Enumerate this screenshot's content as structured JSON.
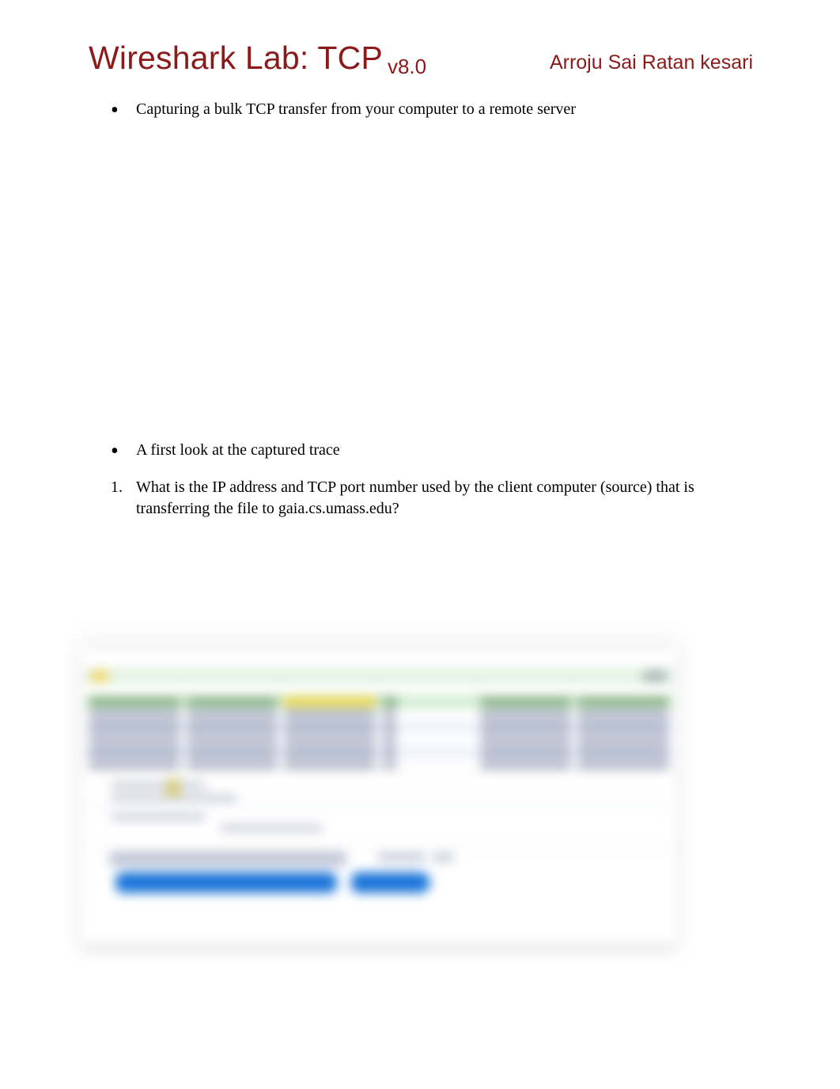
{
  "header": {
    "title": "Wireshark Lab:  TCP",
    "version": "v8.0",
    "author": "Arroju Sai Ratan kesari"
  },
  "bullets": {
    "b1": "Capturing a bulk TCP transfer from your computer to a remote server",
    "b2": " A first look at the captured trace"
  },
  "questions": {
    "q1_num": "1.",
    "q1": "What is the IP address and TCP port number used by the client computer (source) that is transferring the file to gaia.cs.umass.edu?"
  }
}
